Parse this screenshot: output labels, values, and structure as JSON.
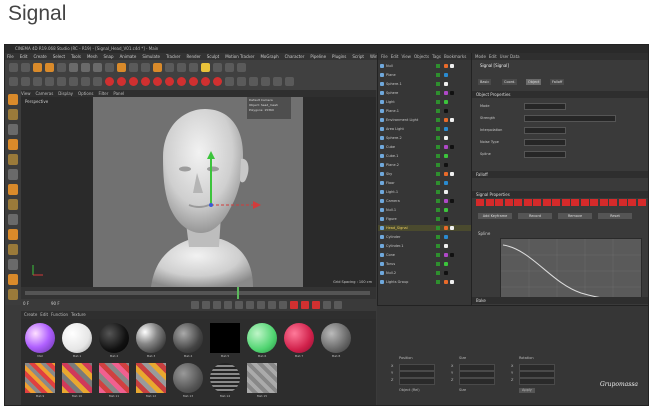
{
  "page": {
    "title": "Signal"
  },
  "window": {
    "title": "CINEMA 4D R19.068 Studio (RC - R19) - [Signal_Head_V01.c4d *] - Main"
  },
  "menubar": {
    "items": [
      "File",
      "Edit",
      "Create",
      "Select",
      "Tools",
      "Mesh",
      "Snap",
      "Animate",
      "Simulate",
      "Tracker",
      "Render",
      "Sculpt",
      "Motion Tracker",
      "MoGraph",
      "Character",
      "Pipeline",
      "Plugins",
      "Script",
      "Window",
      "Help"
    ]
  },
  "viewport": {
    "menu": [
      "View",
      "Cameras",
      "Display",
      "Options",
      "Filter",
      "Panel"
    ],
    "label": "Perspective",
    "hud": [
      "Default Camera",
      "Object: head_mesh",
      "Polygons: 15360"
    ],
    "grid_spacing": "Grid Spacing : 100 cm"
  },
  "object_manager": {
    "menu": [
      "File",
      "Edit",
      "View",
      "Objects",
      "Tags",
      "Bookmarks"
    ],
    "objects": [
      "Null",
      "Plane",
      "Sphere.1",
      "Sphere",
      "Light",
      "Plane.1",
      "Environment Light",
      "Area Light",
      "Sphere.2",
      "Cube",
      "Cube.1",
      "Plane.2",
      "Sky",
      "Floor",
      "Light.1",
      "Camera",
      "Null.1",
      "Figure",
      "Head_Signal",
      "Cylinder",
      "Cylinder.1",
      "Cone",
      "Torus",
      "Null.2",
      "Lights Group"
    ]
  },
  "attribute_manager": {
    "menu": [
      "Mode",
      "Edit",
      "User Data"
    ],
    "header": "Signal [Signal]",
    "tabs": [
      "Basic",
      "Coord.",
      "Object",
      "Falloff"
    ],
    "section_object": "Object Properties",
    "fields": [
      "Mode",
      "Strength",
      "Interpolation",
      "Noise Type",
      "Spline"
    ],
    "section_falloff": "Falloff",
    "section_color": "Signal Properties",
    "buttons": [
      "Add Keyframe",
      "Record",
      "Remove",
      "Reset"
    ],
    "graph_label": "Spline",
    "section_bottom": "Bake"
  },
  "coordinates": {
    "headers": [
      "Position",
      "Size",
      "Rotation"
    ],
    "axes": [
      "X",
      "Y",
      "Z"
    ],
    "apply_label": "Apply",
    "mode_label": "Object (Rel)",
    "size_label": "Size"
  },
  "materials": {
    "tabs": [
      "Create",
      "Edit",
      "Function",
      "Texture"
    ],
    "items": [
      "Mat",
      "Mat.1",
      "Mat.2",
      "Mat.3",
      "Mat.4",
      "Mat.5",
      "Mat.6",
      "Mat.7",
      "Mat.8",
      "Mat.9",
      "Mat.10",
      "Mat.11",
      "Mat.12",
      "Mat.13",
      "Mat.14",
      "Mat.15"
    ]
  },
  "timeline": {
    "current_frame": "0 F",
    "end_frame": "90 F"
  },
  "colors": {
    "accent_orange": "#d98a2a",
    "record_red": "#d03030",
    "keyframe_green": "#5cb85c"
  }
}
